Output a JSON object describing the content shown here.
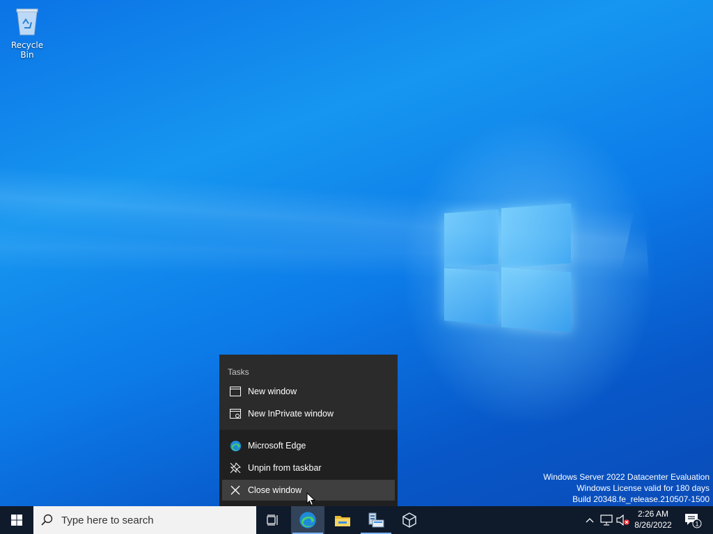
{
  "desktop": {
    "icons": [
      {
        "label": "Recycle Bin",
        "icon": "recycle-bin-icon"
      }
    ],
    "watermark": {
      "line1": "Windows Server 2022 Datacenter Evaluation",
      "line2": "Windows License valid for 180 days",
      "line3": "Build 20348.fe_release.210507-1500"
    }
  },
  "jumplist": {
    "header": "Tasks",
    "tasks": [
      {
        "label": "New window",
        "icon": "window-icon"
      },
      {
        "label": "New InPrivate window",
        "icon": "inprivate-window-icon"
      }
    ],
    "app_actions": [
      {
        "label": "Microsoft Edge",
        "icon": "edge-icon"
      },
      {
        "label": "Unpin from taskbar",
        "icon": "unpin-icon"
      },
      {
        "label": "Close window",
        "icon": "close-icon",
        "highlighted": true
      }
    ]
  },
  "taskbar": {
    "search_placeholder": "Type here to search",
    "pinned": [
      {
        "name": "task-view",
        "icon": "task-view-icon"
      },
      {
        "name": "microsoft-edge",
        "icon": "edge-icon",
        "active": true
      },
      {
        "name": "file-explorer",
        "icon": "folder-icon"
      },
      {
        "name": "server-manager",
        "icon": "server-manager-icon"
      },
      {
        "name": "virtualbox-guest",
        "icon": "cube-icon"
      }
    ],
    "tray": {
      "icons": [
        "chevron-up-icon",
        "network-icon",
        "volume-muted-icon"
      ],
      "time": "2:26 AM",
      "date": "8/26/2022",
      "notification_count": "1"
    }
  },
  "colors": {
    "taskbar": "#0f1a2b",
    "jumplist": "#202020",
    "jumplist_tasks": "#2b2b2b",
    "highlight": "#3f3f3f",
    "desktop": "#0a64d8"
  }
}
